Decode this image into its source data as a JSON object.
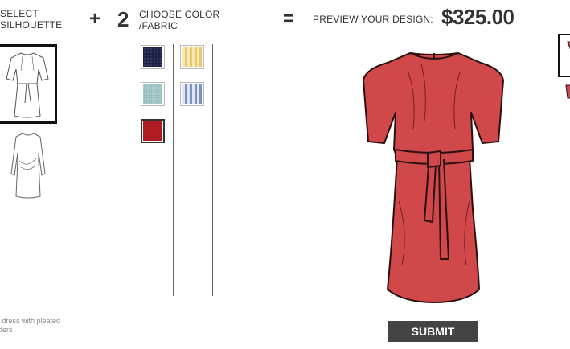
{
  "step1": {
    "label_line1": "SELECT",
    "label_line2": "SILHOUETTE"
  },
  "step2": {
    "operator": "+",
    "number": "2",
    "label_line1": "CHOOSE COLOR",
    "label_line2": "/FABRIC"
  },
  "step3": {
    "operator": "=",
    "label": "PREVIEW YOUR DESIGN:",
    "price": "$325.00"
  },
  "silhouettes": [
    {
      "name": "pleated-dress-with-belt",
      "selected": true
    },
    {
      "name": "long-sleeve-draped-dress",
      "selected": false
    }
  ],
  "caption": {
    "line1": "l dress with pleated",
    "line2": "ders"
  },
  "swatches": [
    {
      "name": "navy-texture",
      "color": "#1c2346",
      "selected": false
    },
    {
      "name": "yellow-stripe",
      "color": "#efd592",
      "selected": false
    },
    {
      "name": "mint-texture",
      "color": "#a9cccc",
      "selected": false
    },
    {
      "name": "blue-stripe",
      "color": "#8aa0c8",
      "selected": false
    },
    {
      "name": "red-solid",
      "color": "#b01c24",
      "selected": true
    }
  ],
  "preview": {
    "dress_color": "#d0484a",
    "outline_color": "#2a1010"
  },
  "submit": {
    "label": "SUBMIT"
  }
}
